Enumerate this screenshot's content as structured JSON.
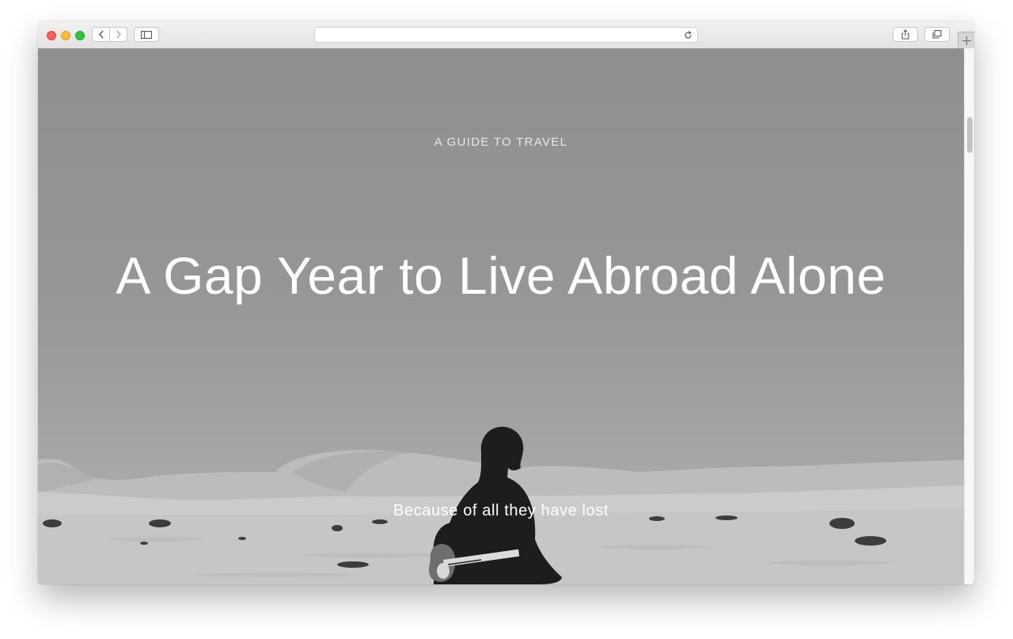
{
  "browser": {
    "url": "",
    "icons": {
      "back": "chevron-left-icon",
      "forward": "chevron-right-icon",
      "sidebar": "sidebar-icon",
      "reload": "reload-icon",
      "share": "share-icon",
      "tabs": "tabs-overview-icon",
      "new_tab": "plus-icon"
    }
  },
  "hero": {
    "eyebrow": "A GUIDE TO TRAVEL",
    "title": "A Gap Year to Live Abroad Alone",
    "subtitle": "Because of all they have lost"
  },
  "colors": {
    "hero_overlay": "#969696",
    "title_text": "#ffffff"
  }
}
